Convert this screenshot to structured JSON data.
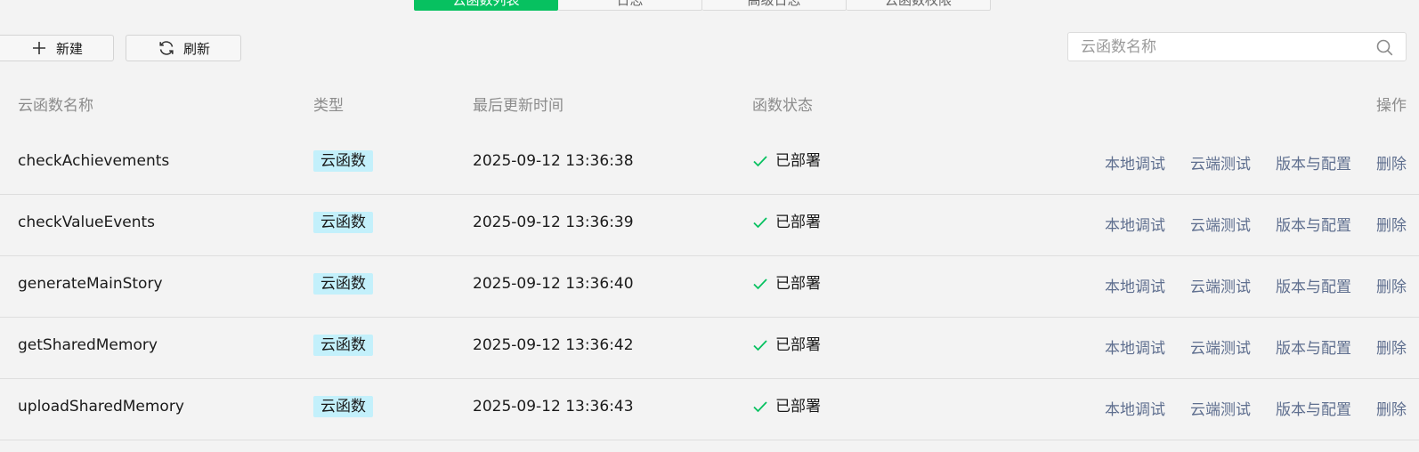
{
  "tabs": [
    {
      "label": "云函数列表",
      "active": true
    },
    {
      "label": "日志",
      "active": false
    },
    {
      "label": "高级日志",
      "active": false
    },
    {
      "label": "云函数权限",
      "active": false
    }
  ],
  "toolbar": {
    "new_label": "新建",
    "refresh_label": "刷新",
    "new_icon": "plus-icon",
    "refresh_icon": "refresh-icon"
  },
  "search": {
    "placeholder": "云函数名称",
    "value": "",
    "icon": "search-icon"
  },
  "table": {
    "headers": {
      "name": "云函数名称",
      "type": "类型",
      "updated": "最后更新时间",
      "status": "函数状态",
      "ops": "操作"
    },
    "action_labels": {
      "local_debug": "本地调试",
      "cloud_test": "云端测试",
      "version_config": "版本与配置",
      "delete": "删除"
    },
    "rows": [
      {
        "name": "checkAchievements",
        "type": "云函数",
        "updated": "2025-09-12 13:36:38",
        "status": "已部署"
      },
      {
        "name": "checkValueEvents",
        "type": "云函数",
        "updated": "2025-09-12 13:36:39",
        "status": "已部署"
      },
      {
        "name": "generateMainStory",
        "type": "云函数",
        "updated": "2025-09-12 13:36:40",
        "status": "已部署"
      },
      {
        "name": "getSharedMemory",
        "type": "云函数",
        "updated": "2025-09-12 13:36:42",
        "status": "已部署"
      },
      {
        "name": "uploadSharedMemory",
        "type": "云函数",
        "updated": "2025-09-12 13:36:43",
        "status": "已部署"
      }
    ]
  },
  "colors": {
    "accent": "#07c160",
    "badge_bg": "#c3f0fb",
    "link": "#5f6f8f",
    "status_check": "#07c160"
  }
}
